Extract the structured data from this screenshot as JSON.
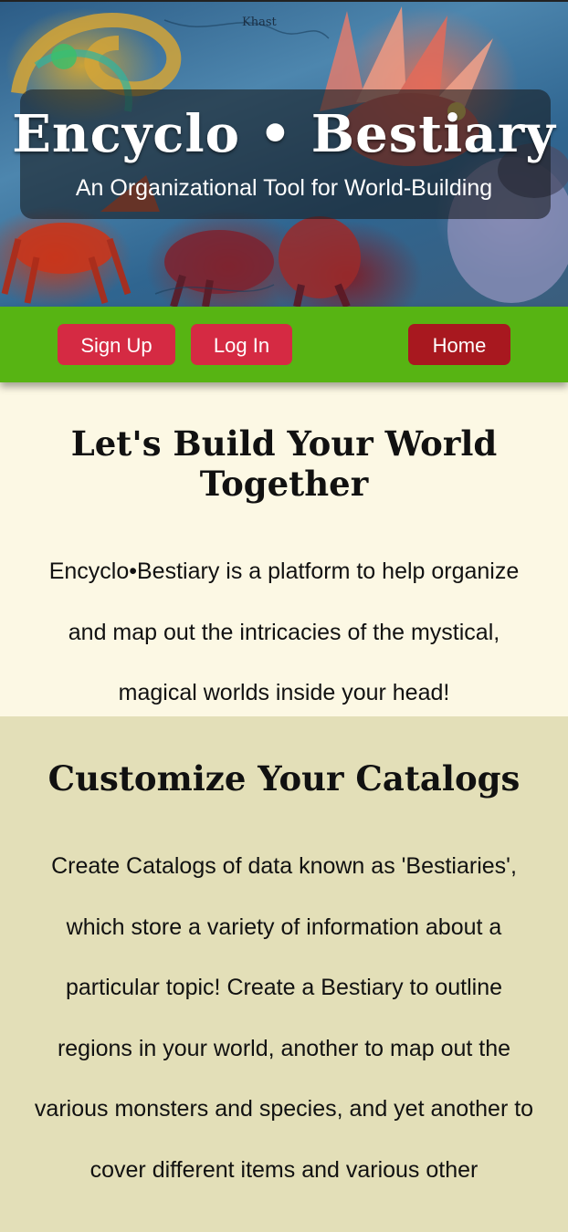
{
  "header": {
    "title": "Encyclo • Bestiary",
    "subtitle": "An Organizational Tool for World-Building",
    "map_label": "Khast"
  },
  "nav": {
    "signup_label": "Sign Up",
    "login_label": "Log In",
    "home_label": "Home"
  },
  "intro": {
    "heading": "Let's Build Your World Together",
    "body": "Encyclo•Bestiary is a platform to help organize and map out the intricacies of the mystical, magical worlds inside your head!"
  },
  "catalogs": {
    "heading": "Customize Your Catalogs",
    "body": "Create Catalogs of data known as 'Bestiaries', which store a variety of information about a particular topic! Create a Bestiary to outline regions in your world, another to map out the various monsters and species, and yet another to cover different items and various other"
  },
  "colors": {
    "nav_green": "#57b413",
    "button_red": "#d52a43",
    "home_dark_red": "#a8181f",
    "intro_bg": "#fcf8e4",
    "catalogs_bg": "#e3dfb8"
  }
}
